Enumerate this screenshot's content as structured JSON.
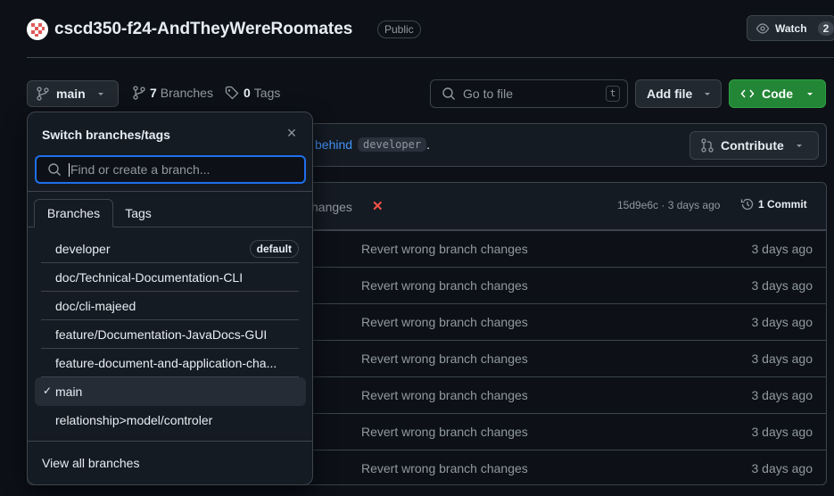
{
  "repo": {
    "name": "cscd350-f24-AndTheyWereRoomates",
    "visibility": "Public",
    "watch_label": "Watch",
    "watch_count": "2"
  },
  "toolbar": {
    "branch_label": "main",
    "branches_count": "7",
    "branches_label": "Branches",
    "tags_count": "0",
    "tags_label": "Tags",
    "goto_placeholder": "Go to file",
    "goto_shortcut": "t",
    "add_file_label": "Add file",
    "code_label": "Code"
  },
  "behind_bar": {
    "link_text": "behind",
    "branch_ref": "developer",
    "trailing": ".",
    "contribute_label": "Contribute"
  },
  "latest_commit": {
    "message_fragment": "hanges",
    "hash": "15d9e6c",
    "separator": " · ",
    "age": "3 days ago",
    "commits_label": "1 Commit"
  },
  "file_rows": [
    {
      "message": "Revert wrong branch changes",
      "age": "3 days ago"
    },
    {
      "message": "Revert wrong branch changes",
      "age": "3 days ago"
    },
    {
      "message": "Revert wrong branch changes",
      "age": "3 days ago"
    },
    {
      "message": "Revert wrong branch changes",
      "age": "3 days ago"
    },
    {
      "message": "Revert wrong branch changes",
      "age": "3 days ago"
    },
    {
      "message": "Revert wrong branch changes",
      "age": "3 days ago"
    },
    {
      "message": "Revert wrong branch changes",
      "age": "3 days ago"
    }
  ],
  "dropdown": {
    "title": "Switch branches/tags",
    "search_placeholder": "Find or create a branch...",
    "tabs": [
      "Branches",
      "Tags"
    ],
    "default_badge": "default",
    "branches": [
      "developer",
      "doc/Technical-Documentation-CLI",
      "doc/cli-majeed",
      "feature/Documentation-JavaDocs-GUI",
      "feature-document-and-application-cha...",
      "main",
      "relationship>model/controler"
    ],
    "view_all": "View all branches"
  },
  "colors": {
    "background": "#0d1117",
    "code_button": "#238636",
    "link": "#4493f8",
    "focus_ring": "#1f6feb",
    "failure": "#f85149"
  }
}
